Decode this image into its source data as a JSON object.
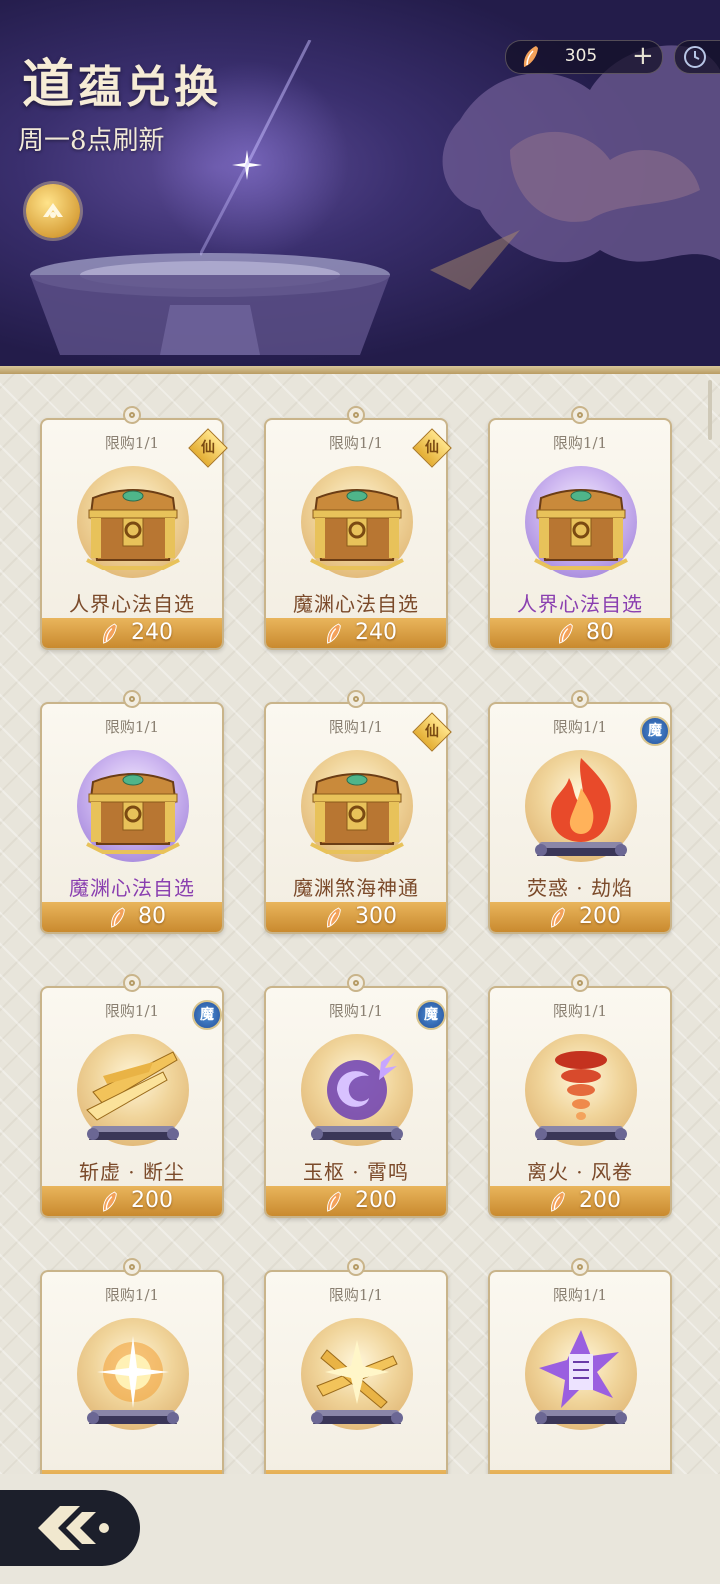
{
  "header": {
    "title_first": "道",
    "title_rest": "蕴兑换",
    "subtitle": "周一8点刷新"
  },
  "currency": {
    "amount": "305",
    "add_label": "+"
  },
  "colors": {
    "accent_gold": "#d9a23c",
    "banner_purple": "#3a2f6e",
    "name_brown": "#7b4a2a",
    "name_purple": "#8a3fb0"
  },
  "items": [
    {
      "limit": "限购1/1",
      "name": "人界心法自选",
      "price": "240",
      "tag": "仙",
      "disc": "gold",
      "icon": "treasure-chest-icon",
      "name_color": "brown"
    },
    {
      "limit": "限购1/1",
      "name": "魔渊心法自选",
      "price": "240",
      "tag": "仙",
      "disc": "gold",
      "icon": "treasure-chest-icon",
      "name_color": "brown"
    },
    {
      "limit": "限购1/1",
      "name": "人界心法自选",
      "price": "80",
      "tag": "",
      "disc": "purple",
      "icon": "treasure-chest-icon",
      "name_color": "purple"
    },
    {
      "limit": "限购1/1",
      "name": "魔渊心法自选",
      "price": "80",
      "tag": "",
      "disc": "purple",
      "icon": "treasure-chest-icon",
      "name_color": "purple"
    },
    {
      "limit": "限购1/1",
      "name": "魔渊煞海神通",
      "price": "300",
      "tag": "仙",
      "disc": "gold",
      "icon": "treasure-chest-icon",
      "name_color": "brown"
    },
    {
      "limit": "限购1/1",
      "name": "荧惑 · 劫焰",
      "price": "200",
      "tag": "魔",
      "disc": "gold",
      "icon": "fire-scroll-icon",
      "name_color": "brown"
    },
    {
      "limit": "限购1/1",
      "name": "斩虚 · 断尘",
      "price": "200",
      "tag": "魔",
      "disc": "gold",
      "icon": "sword-scroll-icon",
      "name_color": "brown"
    },
    {
      "limit": "限购1/1",
      "name": "玉枢 · 霄鸣",
      "price": "200",
      "tag": "魔",
      "disc": "gold",
      "icon": "thunder-orb-scroll-icon",
      "name_color": "brown"
    },
    {
      "limit": "限购1/1",
      "name": "离火 · 风卷",
      "price": "200",
      "tag": "",
      "disc": "gold",
      "icon": "tornado-scroll-icon",
      "name_color": "brown"
    },
    {
      "limit": "限购1/1",
      "name": "",
      "price": "",
      "tag": "",
      "disc": "gold",
      "icon": "light-orb-scroll-icon",
      "name_color": "brown"
    },
    {
      "limit": "限购1/1",
      "name": "",
      "price": "",
      "tag": "",
      "disc": "gold",
      "icon": "blades-scroll-icon",
      "name_color": "brown"
    },
    {
      "limit": "限购1/1",
      "name": "",
      "price": "",
      "tag": "",
      "disc": "gold",
      "icon": "thunder-talisman-scroll-icon",
      "name_color": "brown"
    }
  ]
}
